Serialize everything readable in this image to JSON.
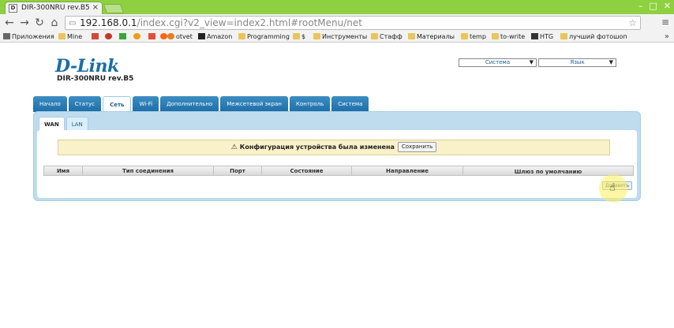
{
  "browser": {
    "tab_title": "DIR-300NRU rev.B5",
    "tab_favicon": "D",
    "tab_close": "×",
    "window_controls": [
      "–",
      "□",
      "✕"
    ],
    "url_host": "192.168.0.1",
    "url_path": "/index.cgi?v2_view=index2.html#rootMenu/net",
    "nav_icons": [
      "back-icon",
      "forward-icon",
      "reload-icon",
      "home-icon"
    ],
    "back": "←",
    "forward": "→",
    "reload": "↻",
    "home": "⌂",
    "star": "☆",
    "menu": "≡"
  },
  "bookmarks": {
    "items": [
      {
        "label": "Приложения",
        "icon": "apps-icon"
      },
      {
        "label": "Mine",
        "icon": "folder-icon"
      },
      {
        "label": "",
        "icon": "gmail-icon"
      },
      {
        "label": "",
        "icon": "bug-icon"
      },
      {
        "label": "",
        "icon": "green-icon"
      },
      {
        "label": "",
        "icon": "circle-icon"
      },
      {
        "label": "",
        "icon": "feed-icon"
      },
      {
        "label": "",
        "icon": "reddit-icon"
      },
      {
        "label": "otvet",
        "icon": "otvet-icon"
      },
      {
        "label": "Amazon",
        "icon": "amazon-icon"
      },
      {
        "label": "Programming",
        "icon": "folder-icon"
      },
      {
        "label": "$",
        "icon": "folder-icon"
      },
      {
        "label": "Инструменты",
        "icon": "folder-icon"
      },
      {
        "label": "Стафф",
        "icon": "folder-icon"
      },
      {
        "label": "Материалы",
        "icon": "folder-icon"
      },
      {
        "label": "temp",
        "icon": "folder-icon"
      },
      {
        "label": "to-write",
        "icon": "folder-icon"
      },
      {
        "label": "HTG",
        "icon": "htg-icon"
      },
      {
        "label": "лучший фотошоп",
        "icon": "folder-icon"
      }
    ],
    "more": "»"
  },
  "header": {
    "logo": "D-Link",
    "model": "DIR-300NRU rev.B5",
    "system_select": "Система",
    "language_select": "Язык"
  },
  "nav": {
    "tabs": [
      "Начало",
      "Статус",
      "Сеть",
      "Wi-Fi",
      "Дополнительно",
      "Межсетевой экран",
      "Контроль",
      "Система"
    ],
    "active": "Сеть"
  },
  "subnav": {
    "tabs": [
      "WAN",
      "LAN"
    ],
    "active": "WAN"
  },
  "notice": {
    "icon": "⚠",
    "text": "Конфигурация устройства была изменена",
    "save_label": "Сохранить"
  },
  "table": {
    "columns": [
      "Имя",
      "Тип соединения",
      "Порт",
      "Состояние",
      "Направление",
      "Шлюз по умолчанию"
    ]
  },
  "actions": {
    "add_label": "Добавить"
  },
  "colors": {
    "chrome_green": "#8fd041",
    "tab_blue": "#1d6ea8",
    "panel_blue": "#bfdcee",
    "notice_yellow": "#f8f1c9"
  }
}
